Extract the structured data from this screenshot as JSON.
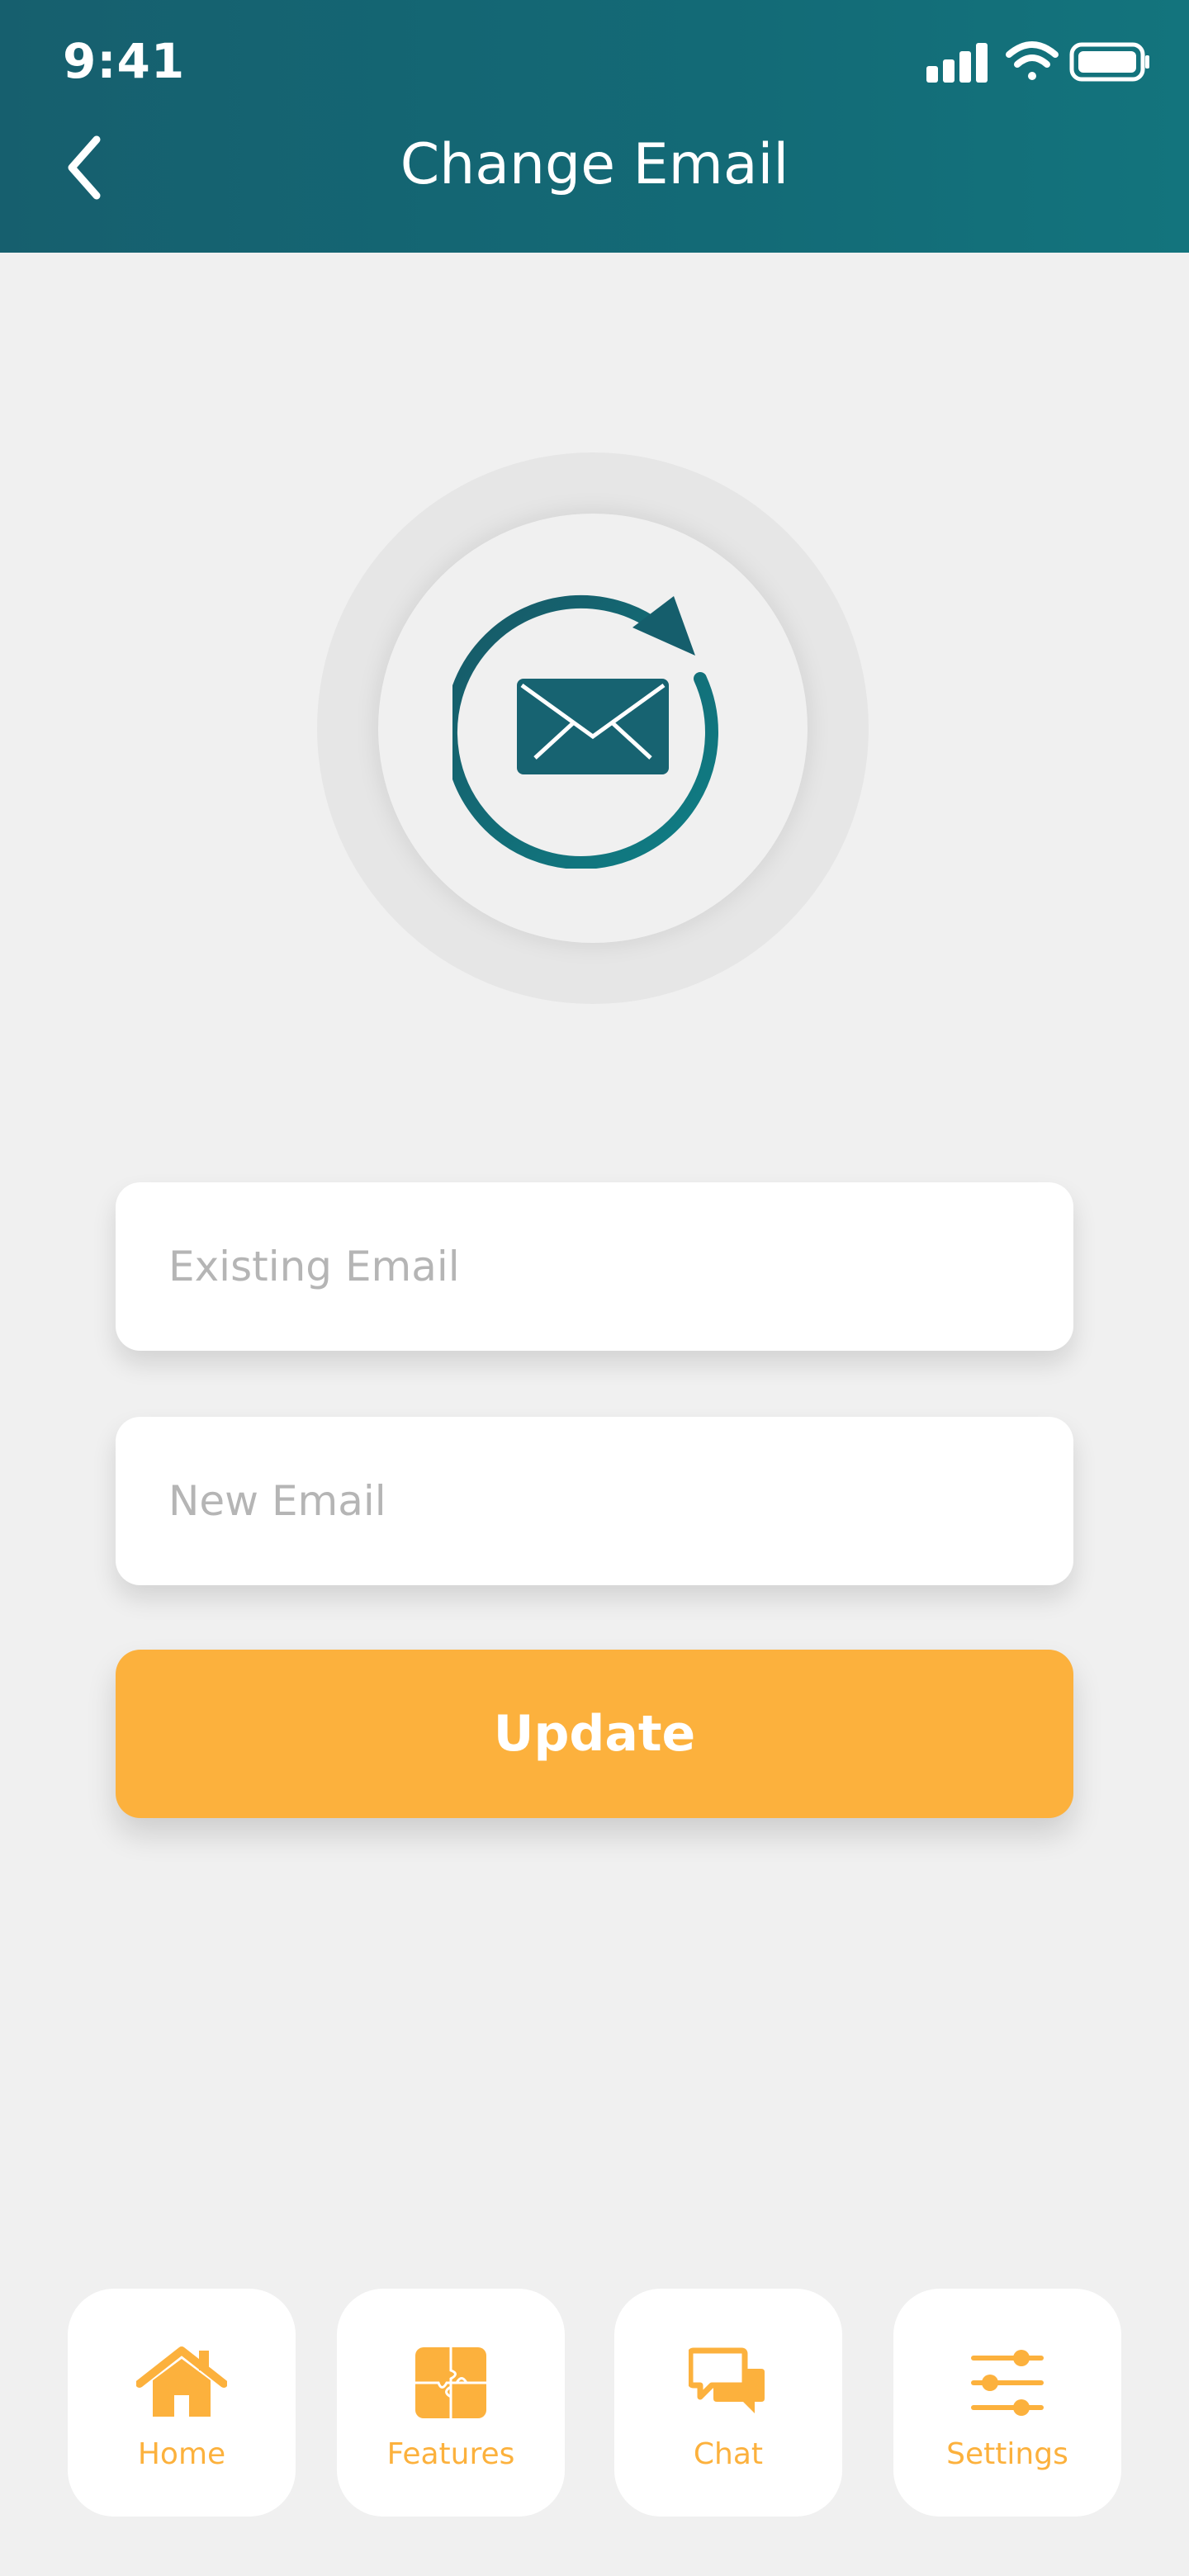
{
  "status_bar": {
    "time": "9:41"
  },
  "header": {
    "title": "Change Email"
  },
  "form": {
    "existing_placeholder": "Existing Email",
    "new_placeholder": "New Email",
    "update_label": "Update"
  },
  "nav": {
    "items": [
      {
        "label": "Home",
        "icon": "home-icon"
      },
      {
        "label": "Features",
        "icon": "puzzle-icon"
      },
      {
        "label": "Chat",
        "icon": "chat-icon"
      },
      {
        "label": "Settings",
        "icon": "sliders-icon"
      }
    ]
  },
  "colors": {
    "header_start": "#165f6e",
    "header_end": "#13747d",
    "accent": "#fcb13d",
    "background": "#f0f0f0"
  }
}
